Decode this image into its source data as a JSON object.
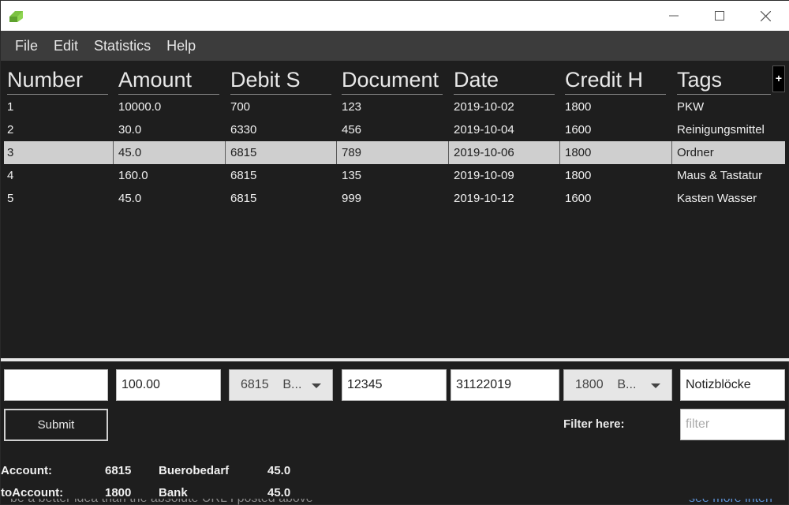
{
  "menu": [
    "File",
    "Edit",
    "Statistics",
    "Help"
  ],
  "table": {
    "columns": [
      "Number",
      "Amount",
      "Debit S",
      "Document",
      "Date",
      "Credit H",
      "Tags"
    ],
    "add_column_label": "+",
    "rows": [
      [
        "1",
        "10000.0",
        "700",
        "123",
        "2019-10-02",
        "1800",
        "PKW"
      ],
      [
        "2",
        "30.0",
        "6330",
        "456",
        "2019-10-04",
        "1600",
        "Reinigungsmittel"
      ],
      [
        "3",
        "45.0",
        "6815",
        "789",
        "2019-10-06",
        "1800",
        "Ordner"
      ],
      [
        "4",
        "160.0",
        "6815",
        "135",
        "2019-10-09",
        "1800",
        "Maus & Tastatur"
      ],
      [
        "5",
        "45.0",
        "6815",
        "999",
        "2019-10-12",
        "1600",
        "Kasten Wasser"
      ]
    ],
    "selected_row": 3
  },
  "form": {
    "number_value": "",
    "amount_value": "100.00",
    "debit_select": "6815    B...",
    "document_value": "12345",
    "date_value": "31122019",
    "credit_select": "1800    B...",
    "tags_value": "Notizblöcke",
    "submit_label": "Submit",
    "filter_label": "Filter here:",
    "filter_placeholder": "filter"
  },
  "info": {
    "account_label": "Account:",
    "account_number": "6815",
    "account_name": "Buerobedarf",
    "account_amount": "45.0",
    "to_account_label": "toAccount:",
    "to_account_number": "1800",
    "to_account_name": "Bank",
    "to_account_amount": "45.0"
  },
  "peek_text_left": "be a better idea than the absolute URL I posted above",
  "peek_text_right": "see more inten",
  "colors": {
    "app_icon": "#7cc242",
    "background": "#1e1e1e",
    "menubar": "#3c3c3c",
    "selected_row": "#cfcfcf"
  }
}
